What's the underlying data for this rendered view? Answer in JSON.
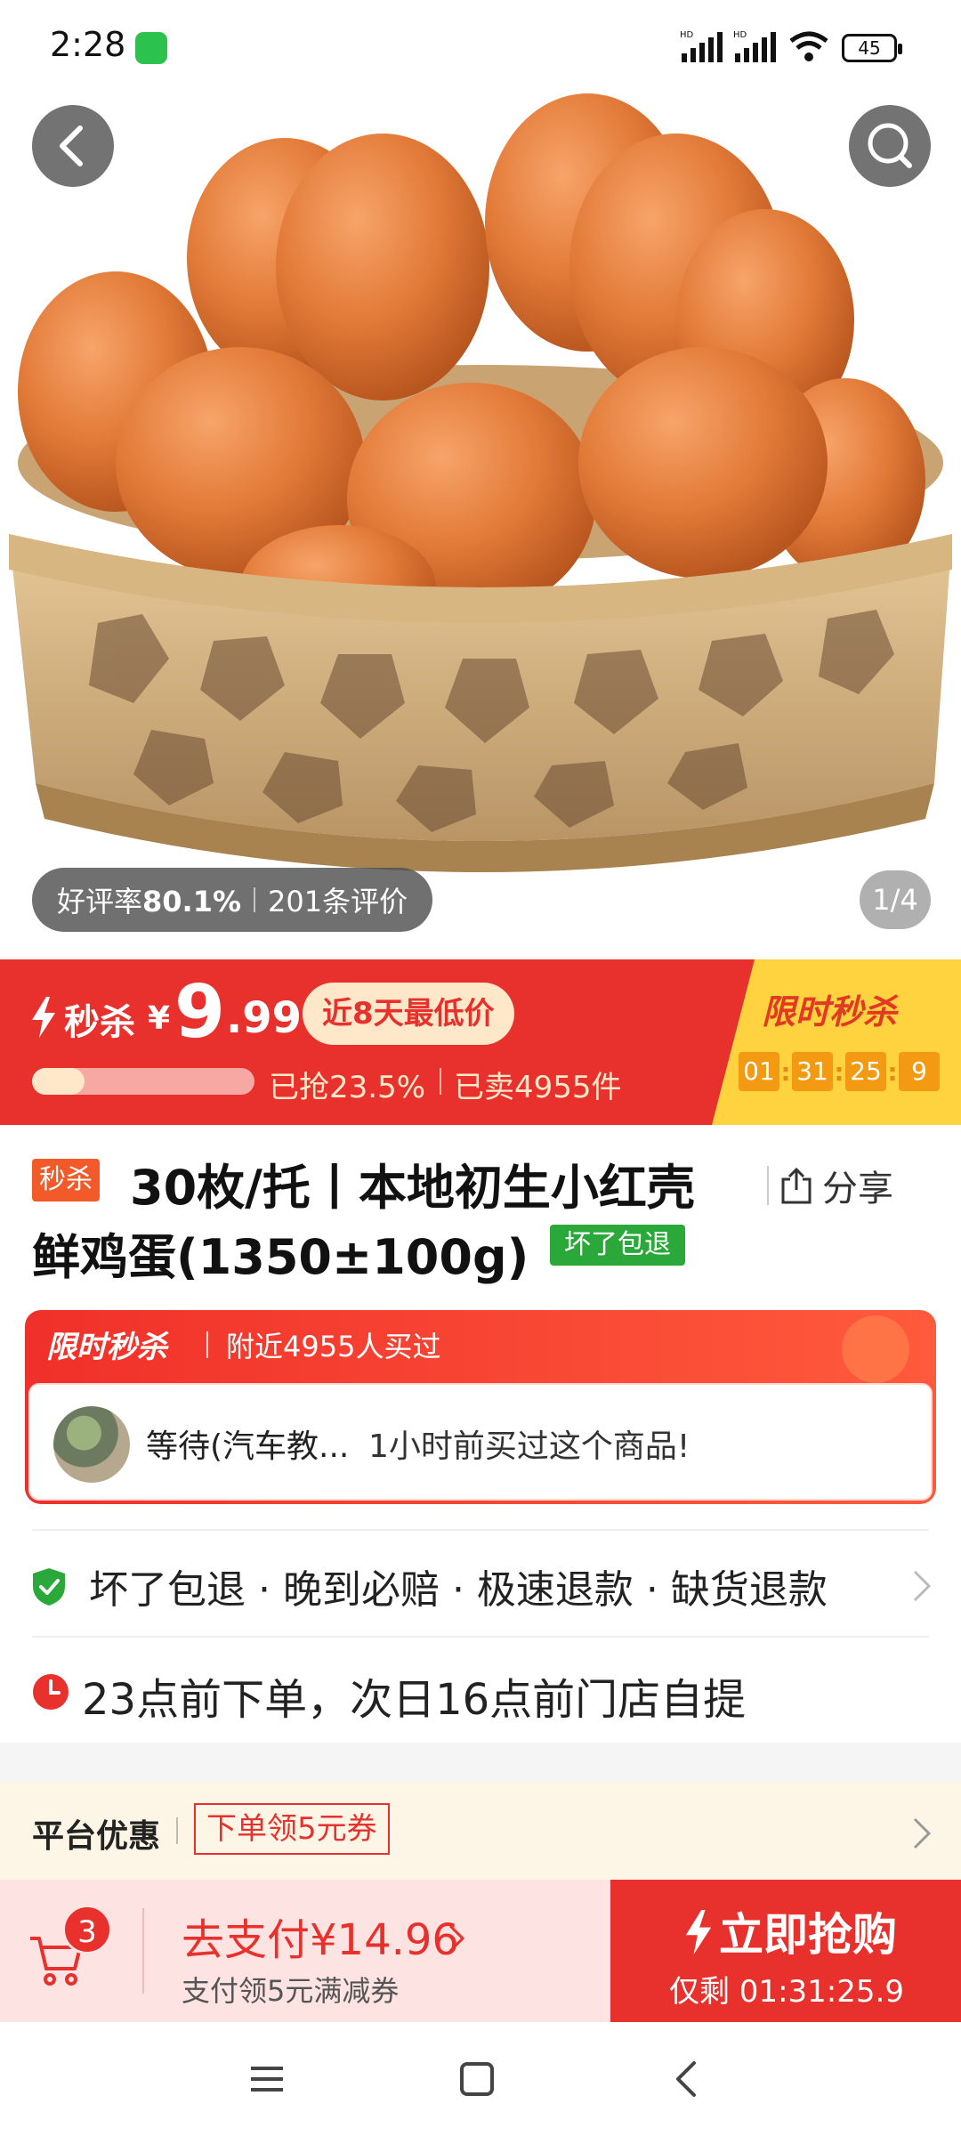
{
  "status_bar": {
    "time": "2:28",
    "battery": "45"
  },
  "gallery": {
    "rating_label": "好评率",
    "rating_value": "80.1%",
    "review_count": "201条评价",
    "pager": "1/4"
  },
  "flash_sale": {
    "label": "秒杀",
    "currency": "¥",
    "price_int": "9",
    "price_dec": ".99",
    "lowest_badge": "近8天最低价",
    "progress_fraction": 0.235,
    "grabbed": "已抢23.5%",
    "sold": "已卖4955件",
    "limited_title": "限时秒杀",
    "countdown": [
      "01",
      "31",
      "25",
      "9"
    ]
  },
  "product": {
    "tag": "秒杀",
    "title_line1": "30枚/托丨本地初生小红壳",
    "title_line2": "鲜鸡蛋(1350±100g)",
    "refund_tag": "坏了包退",
    "share_label": "分享"
  },
  "buyers": {
    "title": "限时秒杀",
    "nearby": "附近4955人买过",
    "buyer_name": "等待(汽车教...",
    "buyer_action": "1小时前买过这个商品!"
  },
  "services": {
    "text": "坏了包退 · 晚到必赔 · 极速退款 · 缺货退款"
  },
  "pickup": {
    "text": "23点前下单，次日16点前门店自提"
  },
  "coupon": {
    "label": "平台优惠",
    "chip": "下单领5元券"
  },
  "action_bar": {
    "cart_count": "3",
    "pay_label": "去支付¥14.96",
    "pay_sub": "支付领5元满减券",
    "buy_label": "立即抢购",
    "remaining": "仅剩 01:31:25.9"
  },
  "colors": {
    "accent_red": "#e8312c",
    "flash_yellow": "#ffd23f",
    "green": "#2aa83a"
  },
  "icons": [
    "back-icon",
    "search-icon",
    "bolt-icon",
    "share-icon",
    "shield-check-icon",
    "clock-icon",
    "chevron-right-icon",
    "cart-icon",
    "menu-icon",
    "home-icon",
    "nav-back-icon"
  ]
}
